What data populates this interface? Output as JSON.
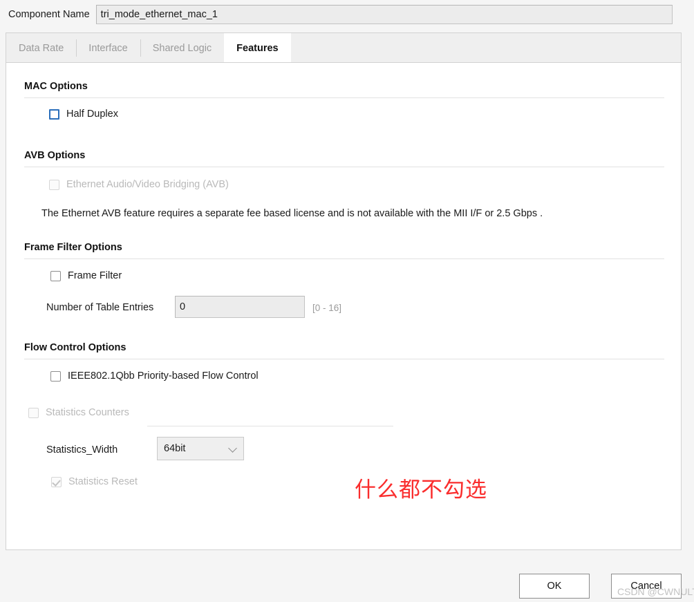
{
  "component_name": {
    "label": "Component Name",
    "value": "tri_mode_ethernet_mac_1"
  },
  "tabs": [
    {
      "label": "Data Rate",
      "active": false
    },
    {
      "label": "Interface",
      "active": false
    },
    {
      "label": "Shared Logic",
      "active": false
    },
    {
      "label": "Features",
      "active": true
    }
  ],
  "sections": {
    "mac_options": {
      "title": "MAC Options",
      "half_duplex": {
        "label": "Half Duplex",
        "checked": false,
        "focused": true,
        "enabled": true
      }
    },
    "avb_options": {
      "title": "AVB Options",
      "avb_checkbox": {
        "label": "Ethernet Audio/Video Bridging (AVB)",
        "checked": false,
        "enabled": false
      },
      "note": "The Ethernet AVB feature requires a separate fee based license and is not available with the MII I/F or 2.5 Gbps ."
    },
    "frame_filter_options": {
      "title": "Frame Filter Options",
      "frame_filter": {
        "label": "Frame Filter",
        "checked": false,
        "enabled": true
      },
      "table_entries": {
        "label": "Number of Table Entries",
        "value": "0",
        "hint": "[0 - 16]",
        "enabled": false
      }
    },
    "flow_control_options": {
      "title": "Flow Control Options",
      "pfc": {
        "label": "IEEE802.1Qbb Priority-based Flow Control",
        "checked": false,
        "enabled": true
      },
      "statistics_counters": {
        "label": "Statistics Counters",
        "checked": false,
        "enabled": false
      },
      "statistics_width": {
        "label": "Statistics_Width",
        "value": "64bit",
        "options": [
          "64bit"
        ],
        "icon": "chevron-down-icon"
      },
      "statistics_reset": {
        "label": "Statistics Reset",
        "checked": true,
        "enabled": false
      }
    }
  },
  "annotation": {
    "text": "什么都不勾选",
    "color": "#fa2d2d"
  },
  "footer": {
    "ok": "OK",
    "cancel": "Cancel"
  },
  "watermark": "CSDN @CWNULT"
}
